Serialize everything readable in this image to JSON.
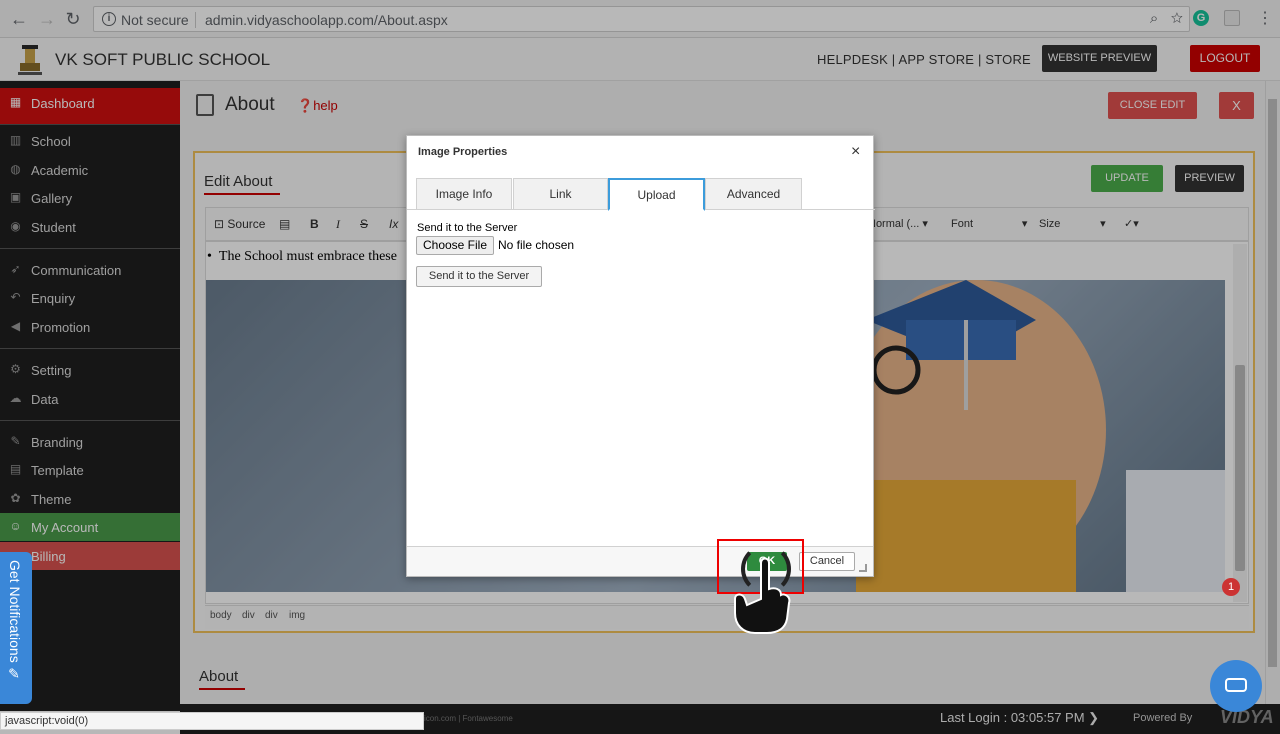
{
  "browser": {
    "security_label": "Not secure",
    "url": "admin.vidyaschoolapp.com/About.aspx"
  },
  "header": {
    "school_name": "VK SOFT PUBLIC SCHOOL",
    "links": "HELPDESK | APP STORE | STORE",
    "website_preview": "WEBSITE PREVIEW",
    "logout": "LOGOUT"
  },
  "sidebar": {
    "items": [
      {
        "label": "Dashboard",
        "icon": "dashboard-icon"
      },
      {
        "label": "School",
        "icon": "school-icon"
      },
      {
        "label": "Academic",
        "icon": "globe-icon"
      },
      {
        "label": "Gallery",
        "icon": "image-icon"
      },
      {
        "label": "Student",
        "icon": "student-icon"
      },
      {
        "label": "Communication",
        "icon": "rocket-icon"
      },
      {
        "label": "Enquiry",
        "icon": "reply-icon"
      },
      {
        "label": "Promotion",
        "icon": "bullhorn-icon"
      },
      {
        "label": "Setting",
        "icon": "gear-icon"
      },
      {
        "label": "Data",
        "icon": "cloud-icon"
      },
      {
        "label": "Branding",
        "icon": "brush-icon"
      },
      {
        "label": "Template",
        "icon": "template-icon"
      },
      {
        "label": "Theme",
        "icon": "paw-icon"
      },
      {
        "label": "My Account",
        "icon": "user-icon"
      },
      {
        "label": "Billing",
        "icon": "billing-icon"
      }
    ]
  },
  "page": {
    "title": "About",
    "help": "help",
    "close_edit": "CLOSE EDIT",
    "close_x": "X",
    "edit_title": "Edit About",
    "update": "UPDATE",
    "preview": "PREVIEW",
    "editor_text": "The School must embrace these",
    "section_label": "About"
  },
  "toolbar": {
    "source": "Source",
    "format": "Normal (...",
    "font": "Font",
    "size": "Size"
  },
  "path_bar": [
    "body",
    "div",
    "div",
    "img"
  ],
  "footer": {
    "last_login": "Last Login : 03:05:57 PM",
    "powered_by": "Powered By",
    "brand": "VIDYA",
    "credit": "icon.com | Fontawesome"
  },
  "status_bar": "javascript:void(0)",
  "notifications": "Get Notifications",
  "dialog": {
    "title": "Image Properties",
    "tabs": [
      "Image Info",
      "Link",
      "Upload",
      "Advanced"
    ],
    "active_tab": "Upload",
    "upload_label": "Send it to the Server",
    "choose_file": "Choose File",
    "no_file": "No file chosen",
    "send_button": "Send it to the Server",
    "ok": "OK",
    "cancel": "Cancel"
  },
  "badge": "1"
}
